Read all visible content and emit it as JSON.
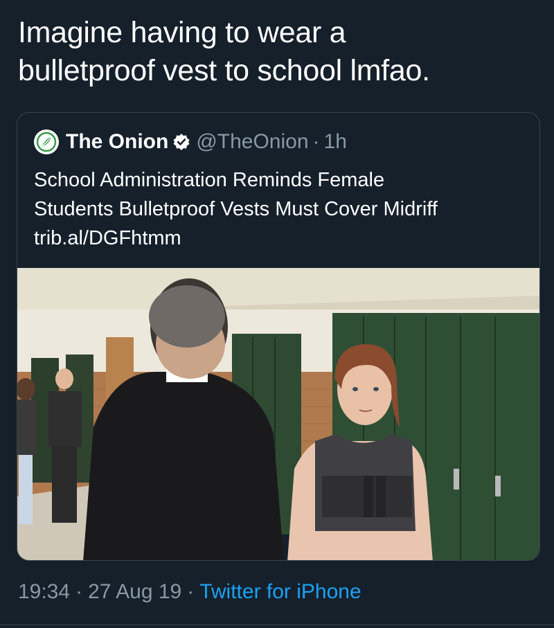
{
  "tweet": {
    "text_line1": "Imagine having to wear a",
    "text_line2": "bulletproof vest to school lmfao."
  },
  "quoted_tweet": {
    "display_name": "The Onion",
    "handle": "@TheOnion",
    "separator": "·",
    "time_ago": "1h",
    "text_line1": "School Administration Reminds Female",
    "text_line2": "Students Bulletproof Vests Must Cover Midriff",
    "link": "trib.al/DGFhtmm",
    "verified_icon": "verified-badge-icon",
    "avatar_icon": "onion-logo"
  },
  "footer": {
    "time": "19:34",
    "separator": "·",
    "date": "27 Aug 19",
    "source": "Twitter for iPhone"
  },
  "colors": {
    "background": "#15202b",
    "secondary_text": "#8899a6",
    "link": "#1da1f2",
    "border": "#38444d",
    "onion_green": "#3a9a4c"
  }
}
